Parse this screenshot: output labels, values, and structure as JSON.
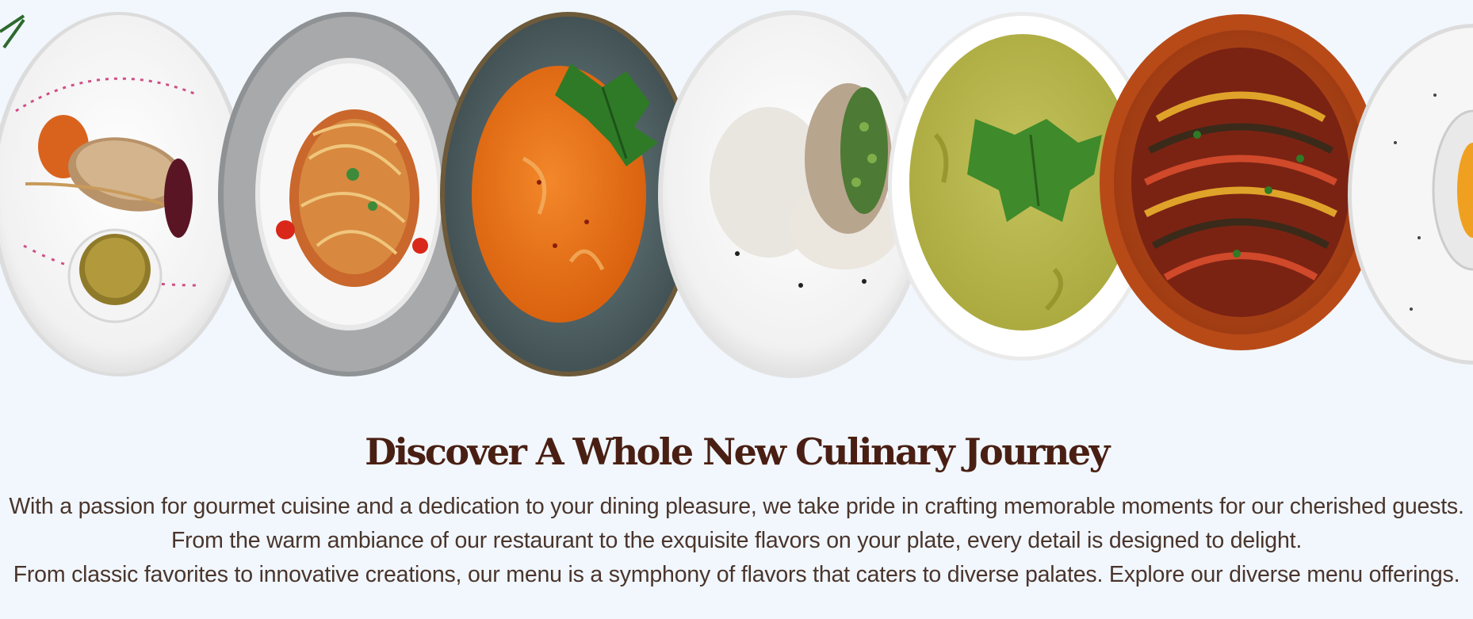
{
  "gallery": {
    "dishes": [
      "Fish fillet with sauce and vegetables",
      "Spaghetti with tomato sauce",
      "Pumpkin soup with cilantro",
      "Steamed bao bun",
      "Green pea soup with herbs",
      "Ratatouille",
      "Dessert plate"
    ]
  },
  "section": {
    "title": "Discover A Whole New Culinary Journey",
    "paragraph_line1": "With a passion for gourmet cuisine and a dedication to your dining pleasure, we take pride in crafting memorable moments for our cherished guests. From the warm ambiance of our restaurant to the exquisite flavors on your plate, every detail is designed to delight.",
    "paragraph_line2": "From classic favorites to innovative creations, our menu is a symphony of flavors that caters to diverse palates. Explore our diverse menu offerings."
  }
}
